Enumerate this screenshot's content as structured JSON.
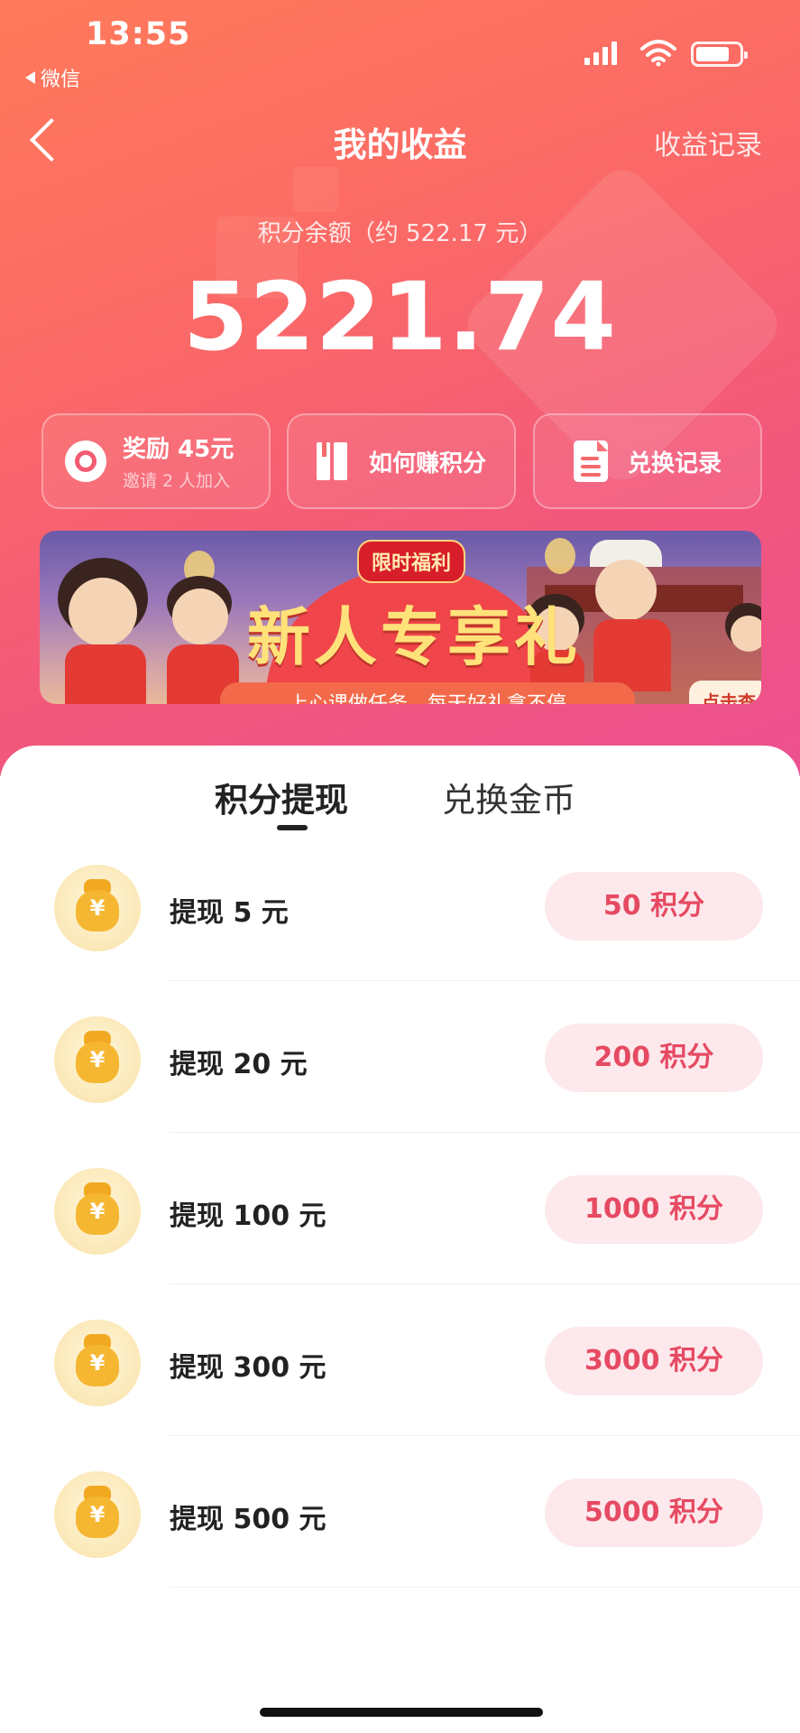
{
  "status_bar": {
    "time": "13:55",
    "back_app": "微信"
  },
  "nav": {
    "title": "我的收益",
    "right_link": "收益记录"
  },
  "balance": {
    "label": "积分余额（约 522.17 元）",
    "value": "5221.74"
  },
  "actions": [
    {
      "title": "奖励 45元",
      "subtitle": "邀请 2 人加入",
      "icon": "target-icon"
    },
    {
      "title": "如何赚积分",
      "icon": "book-icon"
    },
    {
      "title": "兑换记录",
      "icon": "document-icon"
    }
  ],
  "banner": {
    "tag": "限时福利",
    "headline": "新人专享礼",
    "subline": "上心课做任务，每天好礼拿不停",
    "cta": "点击查"
  },
  "tabs": [
    {
      "label": "积分提现",
      "active": true
    },
    {
      "label": "兑换金币",
      "active": false
    }
  ],
  "withdraw_items": [
    {
      "label": "提现 5 元",
      "button": "50 积分",
      "icon": "money-bag-icon"
    },
    {
      "label": "提现 20 元",
      "button": "200 积分",
      "icon": "money-bag-icon"
    },
    {
      "label": "提现 100 元",
      "button": "1000 积分",
      "icon": "money-bag-icon"
    },
    {
      "label": "提现 300 元",
      "button": "3000 积分",
      "icon": "money-bag-icon"
    },
    {
      "label": "提现 500 元",
      "button": "5000 积分",
      "icon": "money-bag-icon"
    }
  ],
  "colors": {
    "header_start": "#ff7a5a",
    "header_end": "#ec5090",
    "accent_text": "#e64a62",
    "pill_bg": "#fde8ec"
  }
}
